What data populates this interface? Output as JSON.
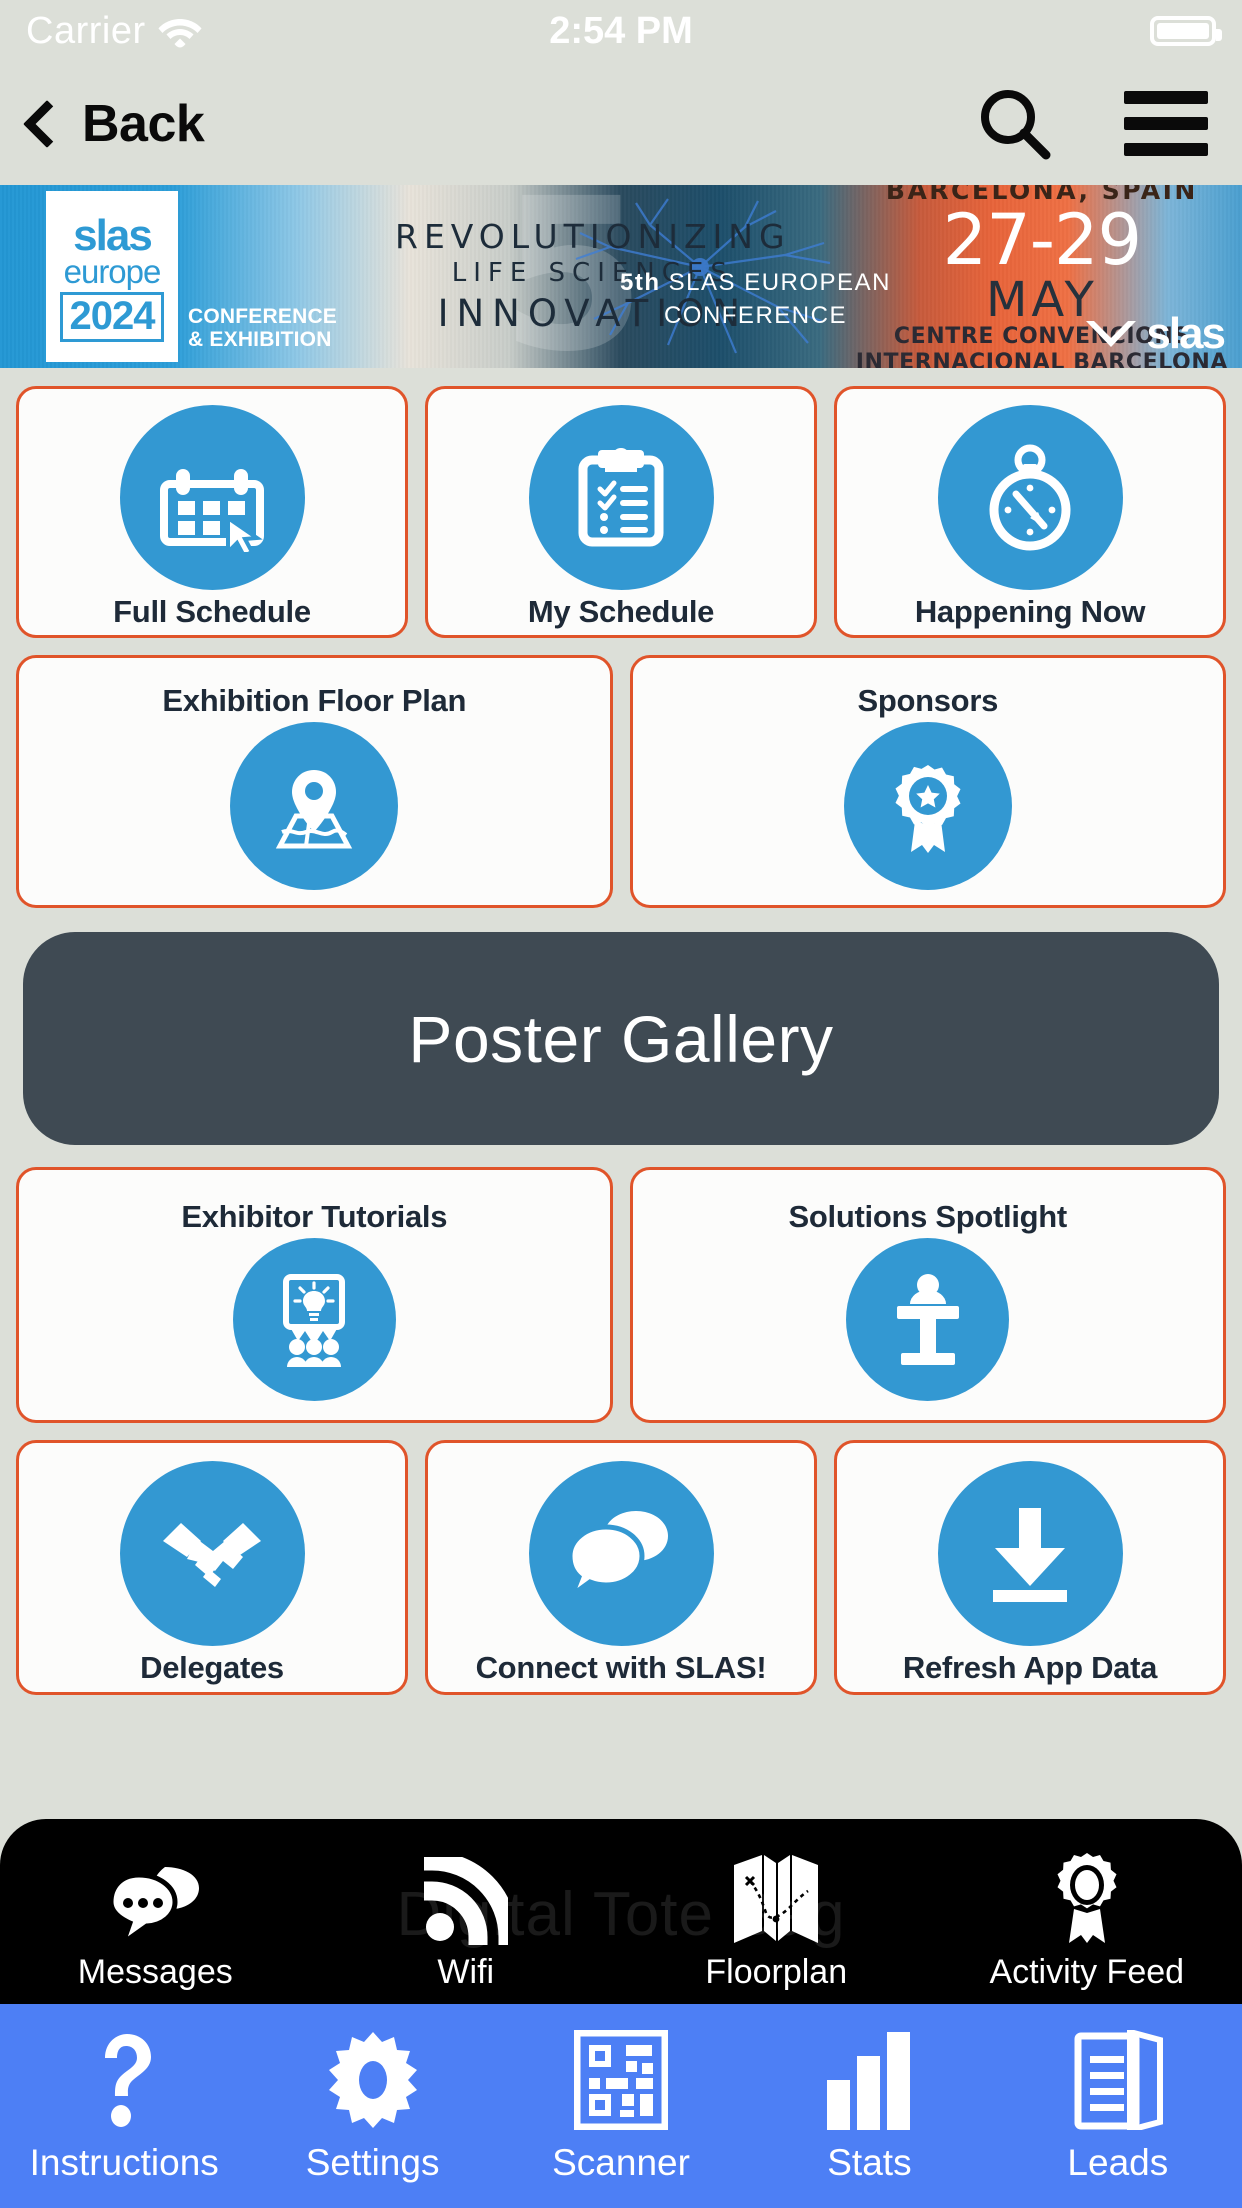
{
  "status_bar": {
    "carrier": "Carrier",
    "time": "2:54 PM",
    "wifi_icon": "wifi-icon",
    "battery_icon": "battery-full-icon"
  },
  "nav_bar": {
    "back_label": "Back",
    "back_icon": "chevron-left-icon",
    "search_icon": "search-icon",
    "menu_icon": "hamburger-menu-icon"
  },
  "banner": {
    "logo_brand": "slas",
    "logo_region": "europe",
    "logo_year": "2024",
    "logo_subtitle_line1": "CONFERENCE",
    "logo_subtitle_line2": "& EXHIBITION",
    "tagline_line1": "REVOLUTIONIZING",
    "tagline_line2": "LIFE SCIENCES",
    "tagline_line3": "INNOVATION",
    "conference_prefix": "5th",
    "conference_name": "SLAS EUROPEAN",
    "conference_name2": "CONFERENCE",
    "city": "BARCELONA, SPAIN",
    "dates": "27-29",
    "month": "MAY",
    "venue_line1": "CENTRE CONVENCIONS",
    "venue_line2": "INTERNACIONAL BARCELONA",
    "brand_mark": "slas"
  },
  "grid": {
    "row1": [
      {
        "label": "Full Schedule",
        "icon": "calendar-cursor-icon"
      },
      {
        "label": "My Schedule",
        "icon": "clipboard-checklist-icon"
      },
      {
        "label": "Happening Now",
        "icon": "stopwatch-compass-icon"
      }
    ],
    "row2": [
      {
        "label": "Exhibition Floor Plan",
        "icon": "map-pin-icon"
      },
      {
        "label": "Sponsors",
        "icon": "award-ribbon-icon"
      }
    ],
    "poster_gallery": {
      "label": "Poster Gallery"
    },
    "row4": [
      {
        "label": "Exhibitor Tutorials",
        "icon": "presentation-lightbulb-audience-icon"
      },
      {
        "label": "Solutions Spotlight",
        "icon": "speaker-podium-icon"
      }
    ],
    "row5": [
      {
        "label": "Delegates",
        "icon": "handshake-icon"
      },
      {
        "label": "Connect with SLAS!",
        "icon": "speech-bubbles-icon"
      },
      {
        "label": "Refresh App Data",
        "icon": "download-arrow-icon"
      }
    ]
  },
  "black_toolbar": {
    "ghost_text": "Digital Tote Bag",
    "items": [
      {
        "label": "Messages",
        "icon": "chat-bubbles-icon"
      },
      {
        "label": "Wifi",
        "icon": "wifi-signal-icon"
      },
      {
        "label": "Floorplan",
        "icon": "folded-map-icon"
      },
      {
        "label": "Activity Feed",
        "icon": "ribbon-award-icon"
      }
    ]
  },
  "blue_toolbar": {
    "items": [
      {
        "label": "Instructions",
        "icon": "question-mark-icon"
      },
      {
        "label": "Settings",
        "icon": "gear-icon"
      },
      {
        "label": "Scanner",
        "icon": "qr-code-icon"
      },
      {
        "label": "Stats",
        "icon": "bar-chart-icon"
      },
      {
        "label": "Leads",
        "icon": "documents-icon"
      }
    ]
  },
  "colors": {
    "page_background": "#dcdfd8",
    "tile_border": "#e0542a",
    "icon_circle": "#3398d2",
    "poster_background": "#3f4a53",
    "blue_toolbar": "#4d7ff5",
    "black_toolbar": "#000000",
    "label_text": "#1e2a38"
  }
}
